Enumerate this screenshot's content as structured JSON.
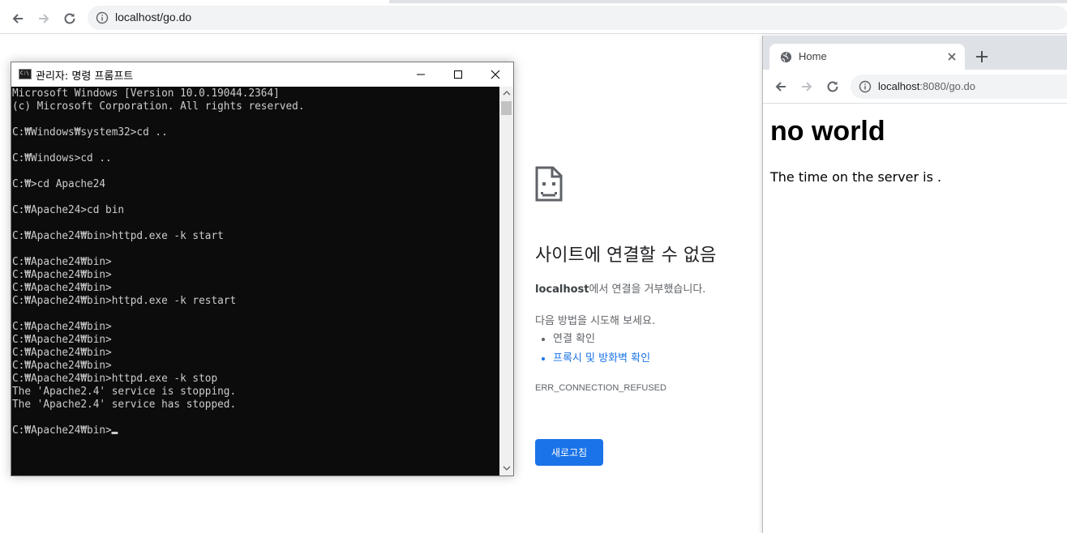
{
  "back_browser": {
    "url": "localhost/go.do"
  },
  "console": {
    "title": "관리자: 명령 프롬프트",
    "lines": [
      "Microsoft Windows [Version 10.0.19044.2364]",
      "(c) Microsoft Corporation. All rights reserved.",
      "",
      "C:\\Windows\\system32>cd ..",
      "",
      "C:\\Windows>cd ..",
      "",
      "C:\\>cd Apache24",
      "",
      "C:\\Apache24>cd bin",
      "",
      "C:\\Apache24\\bin>httpd.exe -k start",
      "",
      "C:\\Apache24\\bin>",
      "C:\\Apache24\\bin>",
      "C:\\Apache24\\bin>",
      "C:\\Apache24\\bin>httpd.exe -k restart",
      "",
      "C:\\Apache24\\bin>",
      "C:\\Apache24\\bin>",
      "C:\\Apache24\\bin>",
      "C:\\Apache24\\bin>",
      "C:\\Apache24\\bin>httpd.exe -k stop",
      "The 'Apache2.4' service is stopping.",
      "The 'Apache2.4' service has stopped.",
      ""
    ],
    "prompt": "C:\\Apache24\\bin>"
  },
  "error_page": {
    "title": "사이트에 연결할 수 없음",
    "host": "localhost",
    "desc_suffix": "에서 연결을 거부했습니다.",
    "try_label": "다음 방법을 시도해 보세요.",
    "suggestions": [
      "연결 확인",
      "프록시 및 방화벽 확인"
    ],
    "error_code": "ERR_CONNECTION_REFUSED",
    "reload_label": "새로고침"
  },
  "front_browser": {
    "tab_title": "Home",
    "url_host": "localhost",
    "url_rest": ":8080/go.do",
    "heading": "no world",
    "paragraph": "The time on the server is ."
  },
  "colors": {
    "link": "#1a73e8",
    "console_bg": "#0c0c0c",
    "console_text": "#cccccc"
  }
}
